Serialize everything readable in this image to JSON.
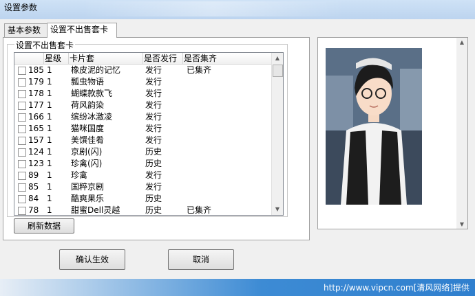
{
  "window": {
    "title": "设置参数"
  },
  "tabs": [
    {
      "label": "基本参数",
      "active": false
    },
    {
      "label": "设置不出售套卡",
      "active": true
    }
  ],
  "group": {
    "legend": "设置不出售套卡"
  },
  "table": {
    "columns": [
      "星级",
      "卡片套",
      "是否发行",
      "是否集齐"
    ],
    "rows": [
      {
        "id": "185",
        "star": "1",
        "name": "橡皮泥的记忆",
        "issued": "发行",
        "collected": "已集齐"
      },
      {
        "id": "179",
        "star": "1",
        "name": "瓢虫物语",
        "issued": "发行",
        "collected": ""
      },
      {
        "id": "178",
        "star": "1",
        "name": "蝴蝶款款飞",
        "issued": "发行",
        "collected": ""
      },
      {
        "id": "177",
        "star": "1",
        "name": "荷风韵染",
        "issued": "发行",
        "collected": ""
      },
      {
        "id": "166",
        "star": "1",
        "name": "缤纷冰激凌",
        "issued": "发行",
        "collected": ""
      },
      {
        "id": "165",
        "star": "1",
        "name": "猫咪国度",
        "issued": "发行",
        "collected": ""
      },
      {
        "id": "157",
        "star": "1",
        "name": "美馔佳肴",
        "issued": "发行",
        "collected": ""
      },
      {
        "id": "124",
        "star": "1",
        "name": "京剧(闪)",
        "issued": "历史",
        "collected": ""
      },
      {
        "id": "123",
        "star": "1",
        "name": "珍禽(闪)",
        "issued": "历史",
        "collected": ""
      },
      {
        "id": "89",
        "star": "1",
        "name": "珍禽",
        "issued": "发行",
        "collected": ""
      },
      {
        "id": "85",
        "star": "1",
        "name": "国粹京剧",
        "issued": "发行",
        "collected": ""
      },
      {
        "id": "84",
        "star": "1",
        "name": "酷爽果乐",
        "issued": "历史",
        "collected": ""
      },
      {
        "id": "78",
        "star": "1",
        "name": "甜蜜Dell灵越",
        "issued": "历史",
        "collected": "已集齐"
      }
    ]
  },
  "buttons": {
    "refresh": "刷新数据",
    "confirm": "确认生效",
    "cancel": "取消"
  },
  "icons": {
    "scroll_up": "scroll-up-arrow-icon",
    "scroll_down": "scroll-down-arrow-icon"
  },
  "watermark": {
    "text": "http://www.vipcn.com[清风网络]提供"
  },
  "colors": {
    "title_bar": "#c7dcf3",
    "watermark_blue": "#3d8bd4"
  }
}
